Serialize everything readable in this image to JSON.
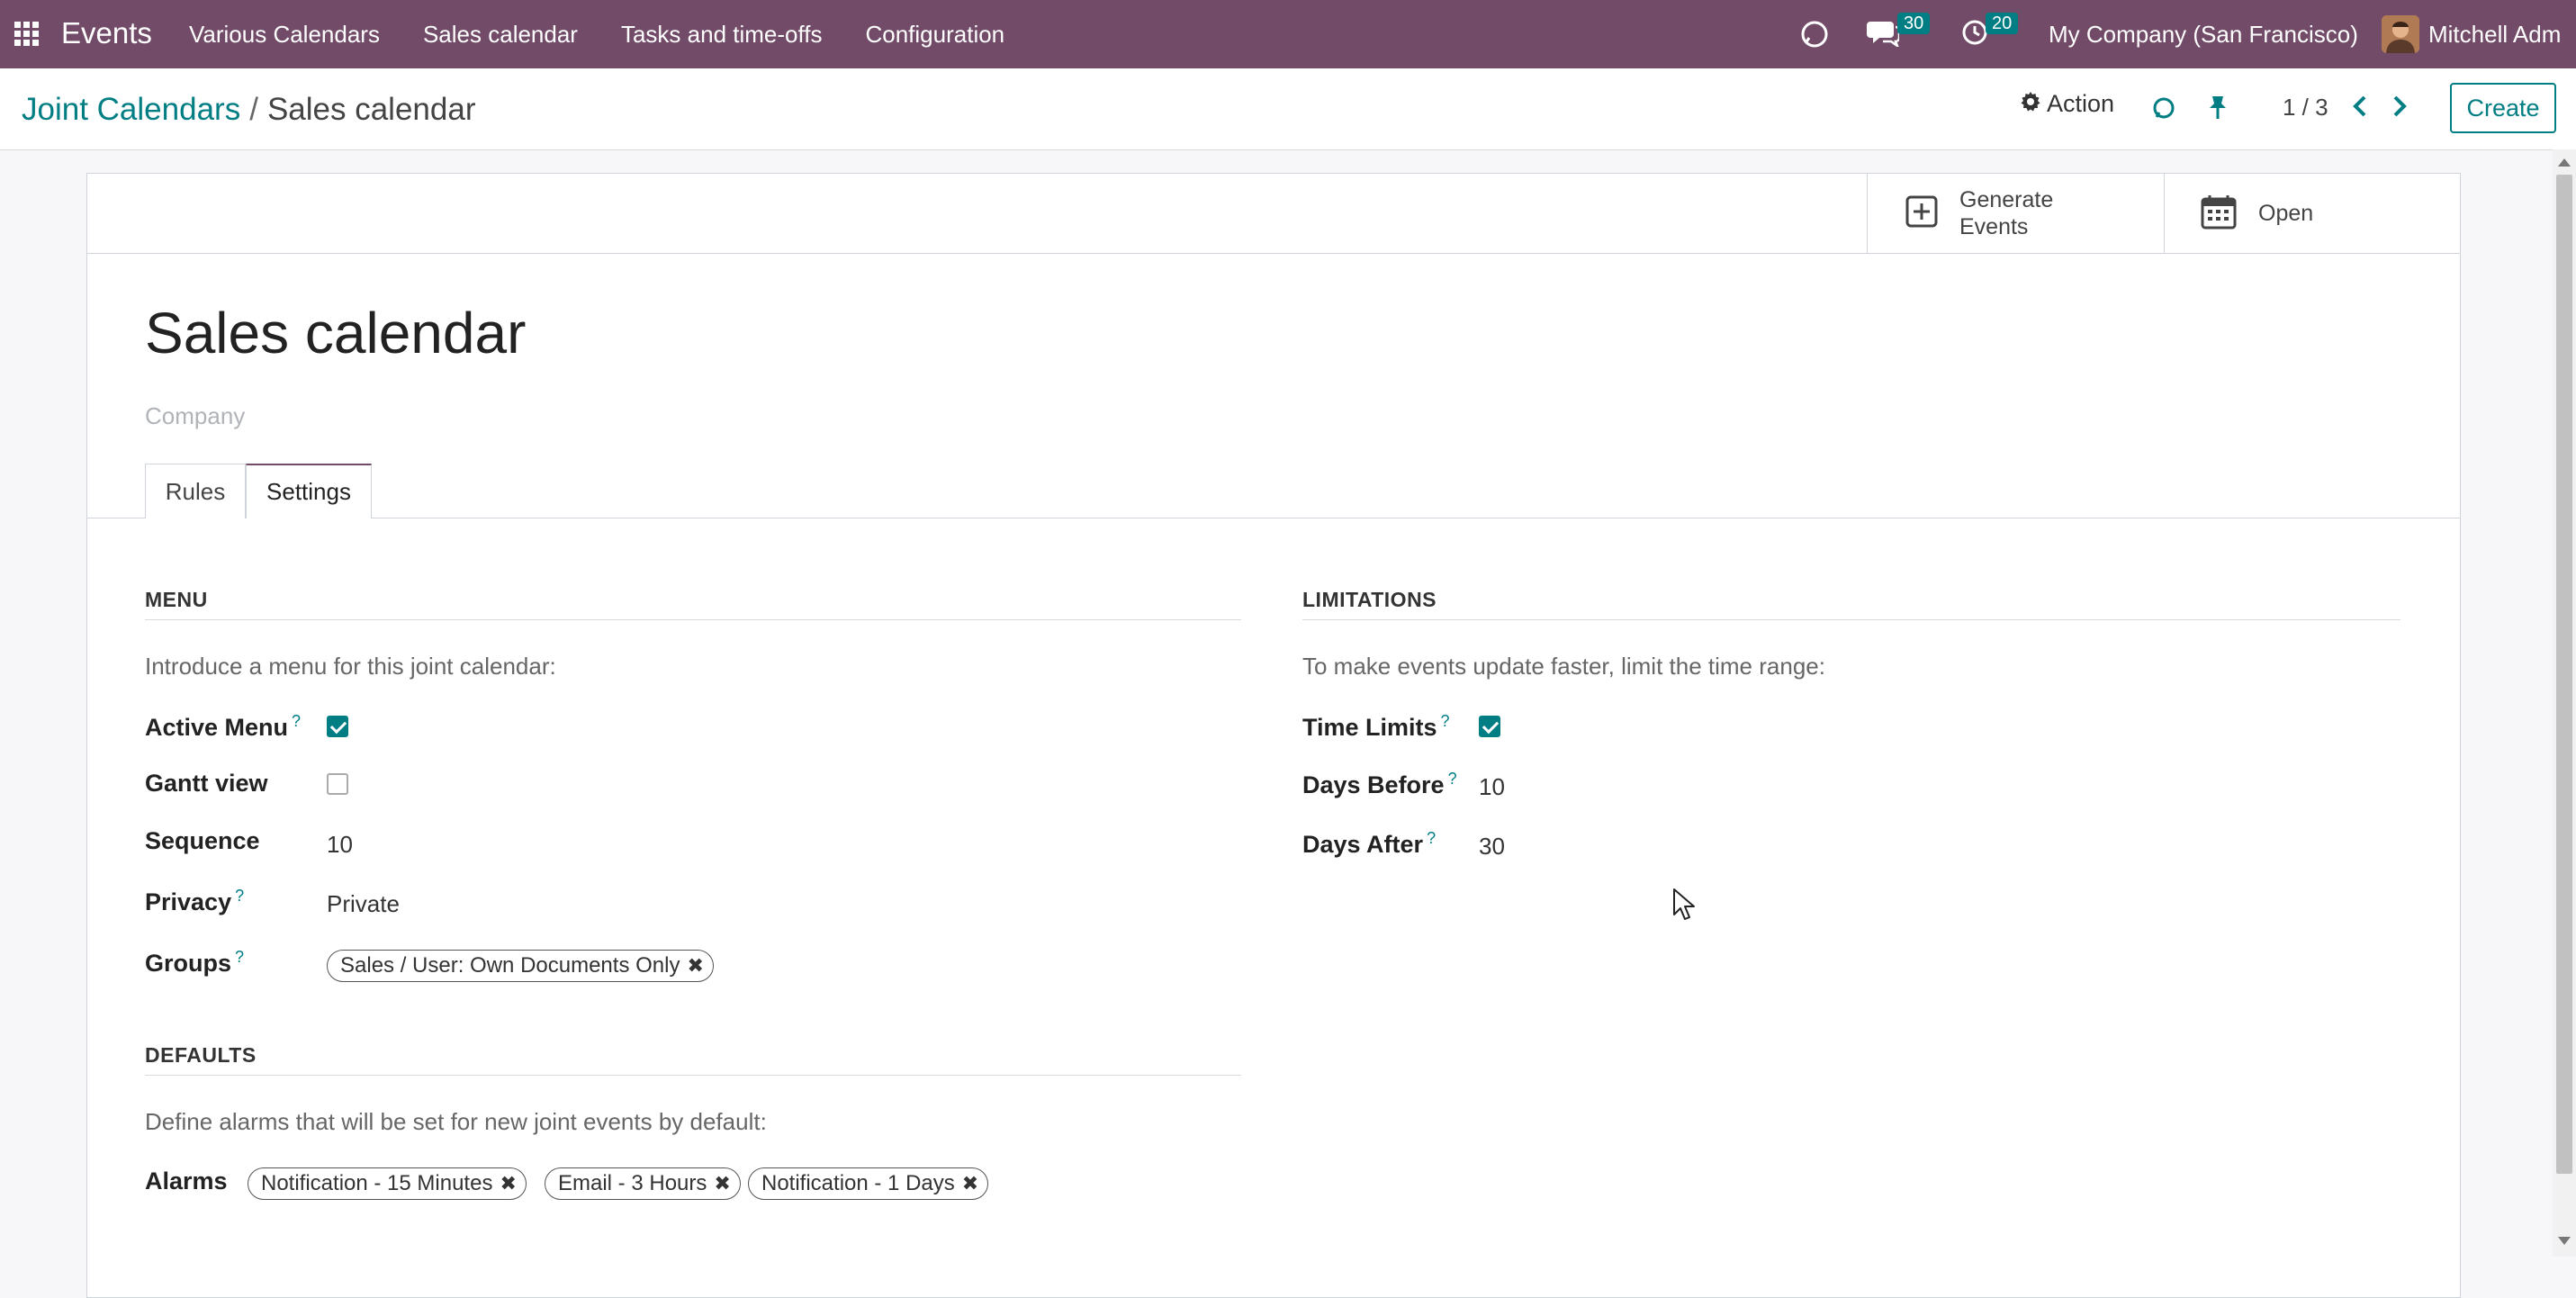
{
  "navbar": {
    "brand": "Events",
    "menu": [
      "Various Calendars",
      "Sales calendar",
      "Tasks and time-offs",
      "Configuration"
    ],
    "messages_count": "30",
    "activities_count": "20",
    "company": "My Company (San Francisco)",
    "user": "Mitchell Adm",
    "colors": {
      "primary": "#714b67",
      "accent": "#017e84"
    }
  },
  "breadcrumb": {
    "parent": "Joint Calendars",
    "separator": "/",
    "current": "Sales calendar"
  },
  "control": {
    "action_label": "Action",
    "pager": "1 / 3",
    "create_label": "Create"
  },
  "buttons": {
    "generate": "Generate Events",
    "open": "Open"
  },
  "record": {
    "title": "Sales calendar",
    "company_placeholder": "Company"
  },
  "tabs": [
    {
      "label": "Rules",
      "active": false
    },
    {
      "label": "Settings",
      "active": true
    }
  ],
  "menu_section": {
    "title": "MENU",
    "helper": "Introduce a menu for this joint calendar:",
    "fields": {
      "active_menu": {
        "label": "Active Menu",
        "checked": true
      },
      "gantt_view": {
        "label": "Gantt view",
        "checked": false
      },
      "sequence": {
        "label": "Sequence",
        "value": "10"
      },
      "privacy": {
        "label": "Privacy",
        "value": "Private"
      },
      "groups": {
        "label": "Groups",
        "tags": [
          "Sales / User: Own Documents Only"
        ]
      }
    }
  },
  "limitations_section": {
    "title": "LIMITATIONS",
    "helper": "To make events update faster, limit the time range:",
    "fields": {
      "time_limits": {
        "label": "Time Limits",
        "checked": true
      },
      "days_before": {
        "label": "Days Before",
        "value": "10"
      },
      "days_after": {
        "label": "Days After",
        "value": "30"
      }
    }
  },
  "defaults_section": {
    "title": "DEFAULTS",
    "helper": "Define alarms that will be set for new joint events by default:",
    "alarms": {
      "label": "Alarms",
      "tags": [
        "Notification - 15 Minutes",
        "Email - 3 Hours",
        "Notification - 1 Days"
      ]
    }
  },
  "icons": [
    "apps-grid-icon",
    "discuss-icon",
    "chat-icon",
    "clock-icon",
    "gear-icon",
    "refresh-icon",
    "pin-icon",
    "chevron-left-icon",
    "chevron-right-icon",
    "plus-square-icon",
    "calendar-icon",
    "remove-tag-icon"
  ]
}
